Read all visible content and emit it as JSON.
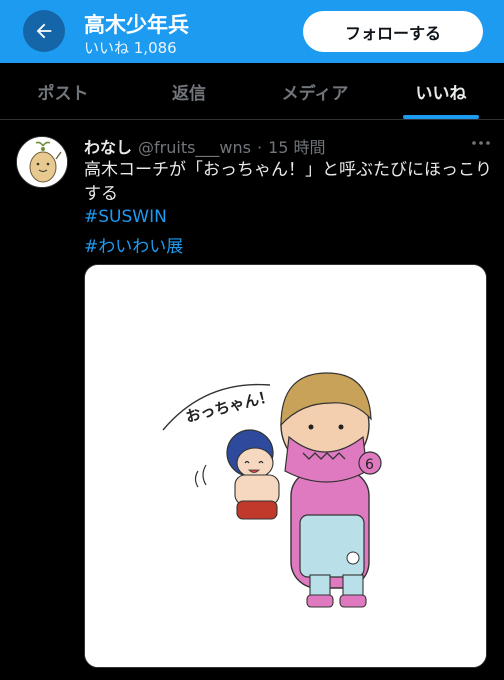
{
  "header": {
    "title": "高木少年兵",
    "subtitle": "いいね 1,086",
    "follow_label": "フォローする",
    "accent": "#1d9bf0"
  },
  "tabs": [
    {
      "label": "ポスト",
      "active": false
    },
    {
      "label": "返信",
      "active": false
    },
    {
      "label": "メディア",
      "active": false
    },
    {
      "label": "いいね",
      "active": true
    }
  ],
  "post": {
    "author_name": "わなし",
    "author_handle": "@fruits___wns",
    "separator": "·",
    "time": "15 時間",
    "text": "高木コーチが「おっちゃん！」と呼ぶたびにほっこりする",
    "hashtags": [
      "#SUSWIN",
      "#わいわい展"
    ],
    "image_caption": "おっちゃん！",
    "icons": {
      "back": "arrow-left-icon",
      "more": "more-horizontal-icon"
    }
  }
}
